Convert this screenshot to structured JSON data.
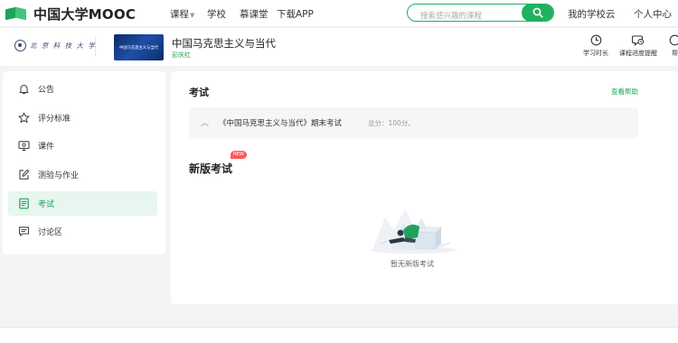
{
  "topnav": {
    "logo_text": "中国大学MOOC",
    "items": [
      {
        "label": "课程",
        "has_caret": true
      },
      {
        "label": "学校"
      },
      {
        "label": "慕课堂"
      },
      {
        "label": "下载APP"
      }
    ],
    "search_placeholder": "搜索感兴趣的课程",
    "right_links": [
      "我的学校云",
      "个人中心"
    ]
  },
  "course": {
    "school_name": "北 京 科 技 大 学",
    "thumbnail_text": "中国马克思主义与当代",
    "title": "中国马克思主义与当代",
    "teacher": "彭庆红",
    "tools": [
      {
        "label": "学习时长",
        "icon": "clock-icon"
      },
      {
        "label": "课程进度提醒",
        "icon": "reminder-icon"
      },
      {
        "label": "帮",
        "icon": "help-icon"
      }
    ]
  },
  "sidebar": {
    "items": [
      {
        "label": "公告",
        "icon": "bell-icon"
      },
      {
        "label": "评分标准",
        "icon": "star-icon"
      },
      {
        "label": "课件",
        "icon": "courseware-icon"
      },
      {
        "label": "测验与作业",
        "icon": "edit-icon"
      },
      {
        "label": "考试",
        "icon": "exam-icon",
        "active": true
      },
      {
        "label": "讨论区",
        "icon": "discussion-icon"
      }
    ]
  },
  "main": {
    "section_title": "考试",
    "help_link": "查看帮助",
    "exam": {
      "name": "《中国马克思主义与当代》期末考试",
      "score": "总分：100分。"
    },
    "new_exam_title": "新版考试",
    "new_badge": "NEW",
    "empty_text": "暂无新版考试"
  },
  "colors": {
    "brand_green": "#1fa35c",
    "active_bg": "#e7f6ee",
    "badge_red": "#ff5a5a"
  }
}
